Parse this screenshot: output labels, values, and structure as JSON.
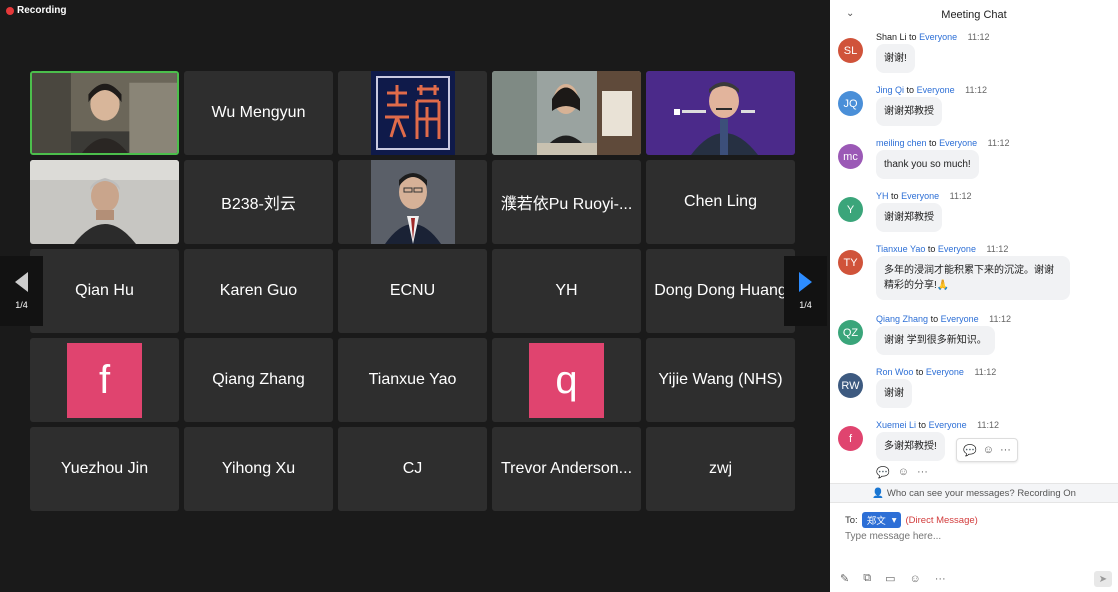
{
  "recording": {
    "label": "Recording"
  },
  "nav": {
    "left_page": "1/4",
    "right_page": "1/4"
  },
  "tiles": [
    {
      "type": "photo",
      "name": ""
    },
    {
      "type": "name",
      "name": "Wu Mengyun"
    },
    {
      "type": "logo",
      "name": ""
    },
    {
      "type": "photo",
      "name": ""
    },
    {
      "type": "photo",
      "name": ""
    },
    {
      "type": "photo",
      "name": ""
    },
    {
      "type": "name",
      "name": "B238-刘云"
    },
    {
      "type": "photo",
      "name": ""
    },
    {
      "type": "name",
      "name": "濮若依Pu Ruoyi-..."
    },
    {
      "type": "name",
      "name": "Chen Ling"
    },
    {
      "type": "name",
      "name": "Qian Hu"
    },
    {
      "type": "name",
      "name": "Karen Guo"
    },
    {
      "type": "name",
      "name": "ECNU"
    },
    {
      "type": "name",
      "name": "YH"
    },
    {
      "type": "name",
      "name": "Dong Dong Huang"
    },
    {
      "type": "letter",
      "name": "f"
    },
    {
      "type": "name",
      "name": "Qiang Zhang"
    },
    {
      "type": "name",
      "name": "Tianxue Yao"
    },
    {
      "type": "letter",
      "name": "q"
    },
    {
      "type": "name",
      "name": "Yijie Wang (NHS)"
    },
    {
      "type": "name",
      "name": "Yuezhou Jin"
    },
    {
      "type": "name",
      "name": "Yihong Xu"
    },
    {
      "type": "name",
      "name": "CJ"
    },
    {
      "type": "name",
      "name": "Trevor Anderson..."
    },
    {
      "type": "name",
      "name": "zwj"
    }
  ],
  "chat": {
    "title": "Meeting Chat",
    "to_word": "to",
    "messages": [
      {
        "initials": "SL",
        "color": "#d0533a",
        "sender": "Shan Li",
        "recipient": "Everyone",
        "time": "11:12",
        "text": "谢谢!"
      },
      {
        "initials": "JQ",
        "color": "#4a8fd8",
        "sender": "Jing Qi",
        "recipient": "Everyone",
        "time": "11:12",
        "text": "谢谢郑教授"
      },
      {
        "initials": "mc",
        "color": "#9b59b6",
        "sender": "meiling chen",
        "recipient": "Everyone",
        "time": "11:12",
        "text": "thank you so much!"
      },
      {
        "initials": "Y",
        "color": "#3aa57a",
        "sender": "YH",
        "recipient": "Everyone",
        "time": "11:12",
        "text": "谢谢郑教授"
      },
      {
        "initials": "TY",
        "color": "#d0533a",
        "sender": "Tianxue Yao",
        "recipient": "Everyone",
        "time": "11:12",
        "text": "多年的浸润才能积累下来的沉淀。谢谢精彩的分享!🙏"
      },
      {
        "initials": "QZ",
        "color": "#3aa57a",
        "sender": "Qiang Zhang",
        "recipient": "Everyone",
        "time": "11:12",
        "text": "谢谢 学到很多新知识。"
      },
      {
        "initials": "RW",
        "color": "#3d5a80",
        "sender": "Ron Woo",
        "recipient": "Everyone",
        "time": "11:12",
        "text": "谢谢"
      },
      {
        "initials": "f",
        "color": "#e0446f",
        "sender": "Xuemei Li",
        "recipient": "Everyone",
        "time": "11:12",
        "text": "多谢郑教授!"
      }
    ],
    "privacy": "Who can see your messages? Recording On",
    "to_label": "To:",
    "to_recipient": "郑文",
    "dm_label": "(Direct Message)",
    "input_placeholder": "Type message here..."
  },
  "colors": {
    "accent": "#2d6fd6",
    "active_speaker": "#4cbf4c",
    "letter_avatar": "#e0446f"
  }
}
